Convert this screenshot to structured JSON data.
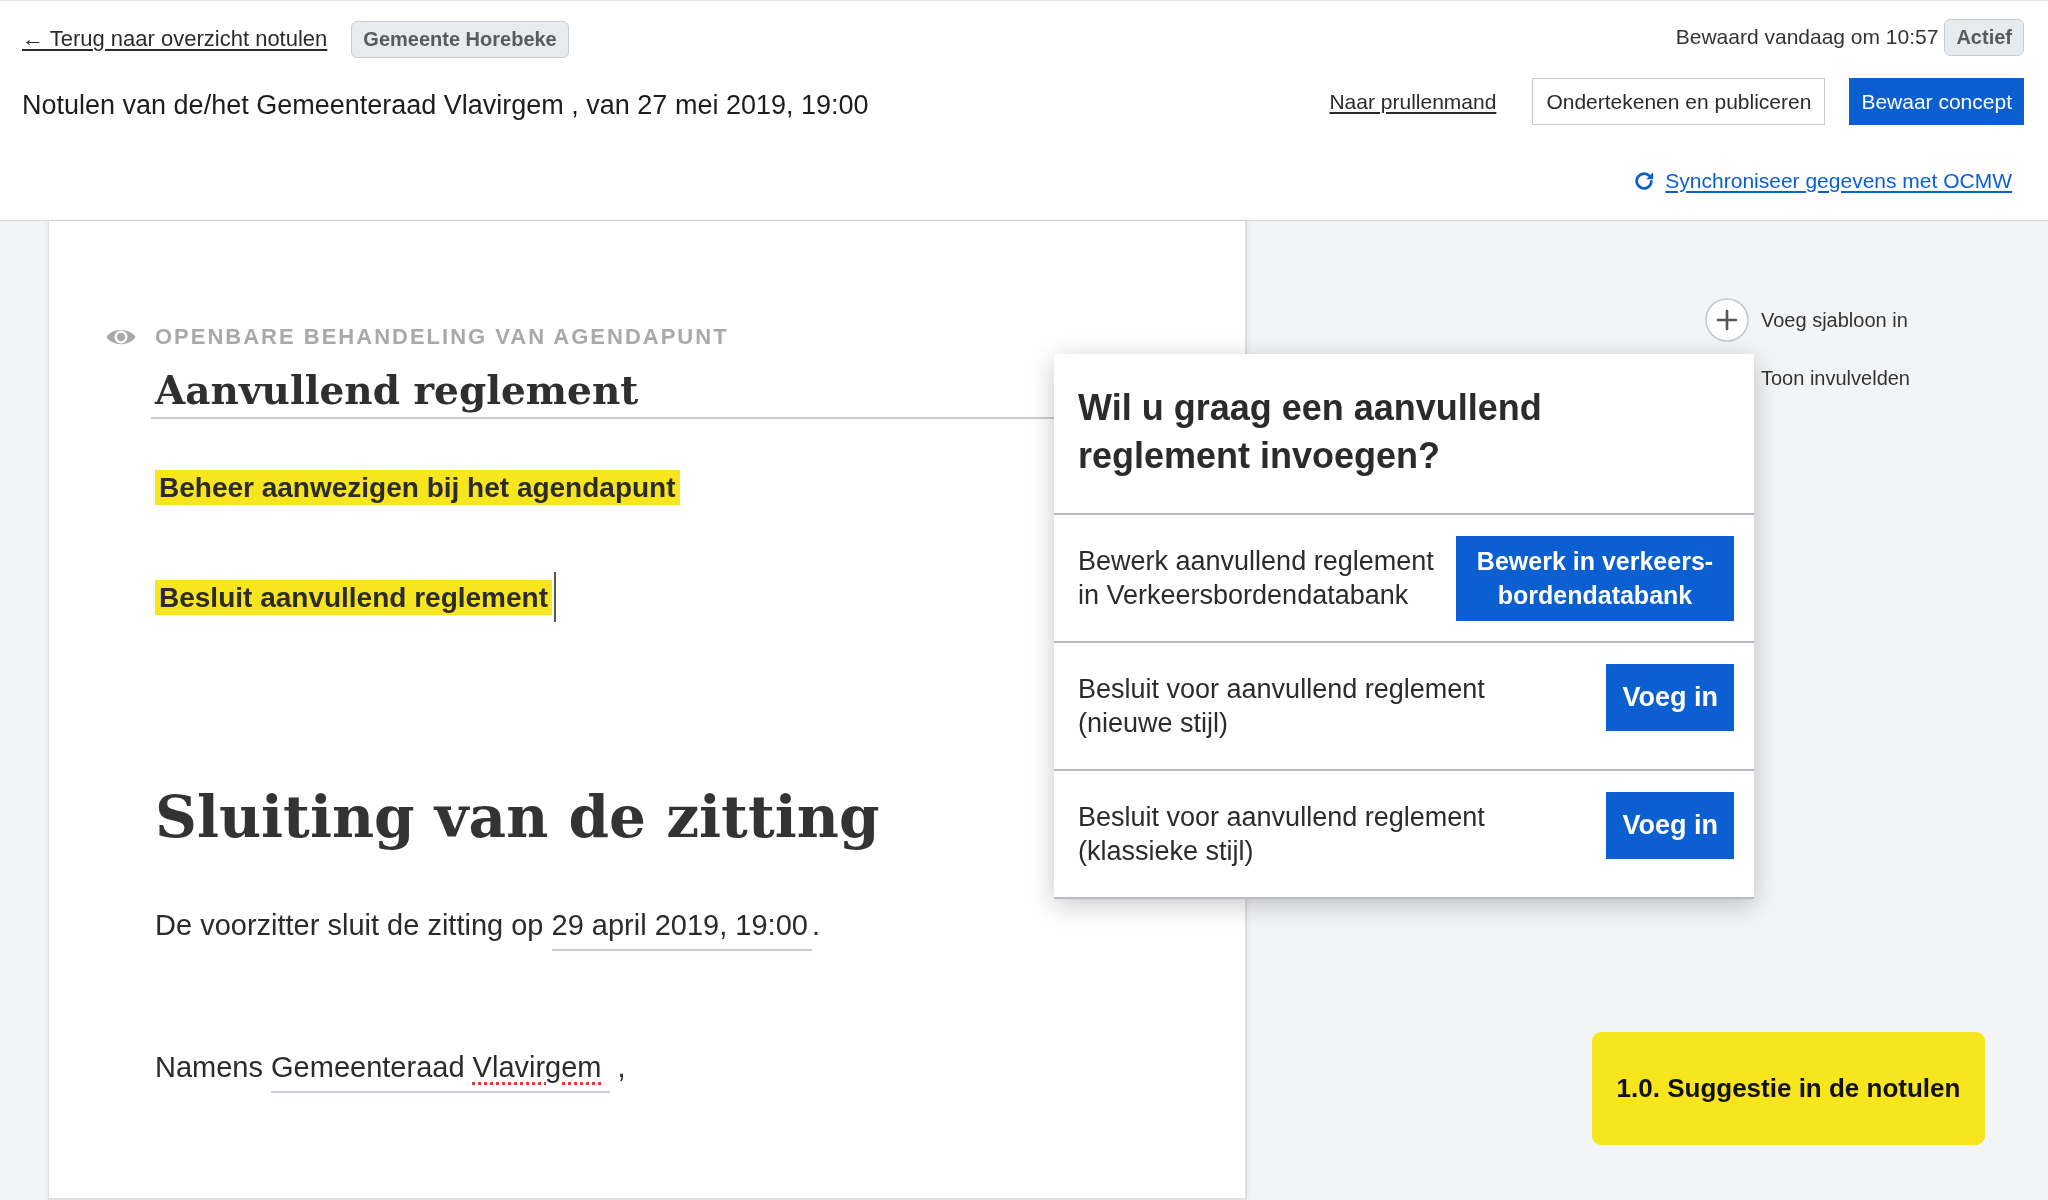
{
  "header": {
    "back_link": "← Terug naar overzicht notulen",
    "organization": "Gemeente Horebeke",
    "save_status": "Bewaard vandaag om 10:57",
    "status_badge": "Actief",
    "title": "Notulen van de/het Gemeenteraad Vlavirgem , van 27 mei 2019, 19:00",
    "actions": [
      {
        "kind": "link",
        "label": "Naar prullenmand"
      },
      {
        "kind": "secondary",
        "label": "Ondertekenen en publiceren"
      },
      {
        "kind": "primary",
        "label": "Bewaar concept"
      }
    ],
    "sync_link": "Synchroniseer gegevens met OCMW"
  },
  "document": {
    "section_label": "OPENBARE BEHANDELING VAN AGENDAPUNT",
    "agenda_title": "Aanvullend reglement",
    "highlighted_blocks": [
      {
        "text": "Beheer aanwezigen bij het agendapunt",
        "caret": false
      },
      {
        "text": "Besluit aanvullend reglement",
        "caret": true
      }
    ],
    "closing_heading": "Sluiting van de zitting",
    "closing_paragraph": {
      "before": "De voorzitter sluit de zitting op",
      "field": "29 april 2019, 19:00",
      "after": "."
    },
    "signature_line": {
      "before": "Namens",
      "field_words": [
        {
          "text": "Gemeenteraad",
          "misspelled": false
        },
        {
          "text": "Vlavirgem",
          "misspelled": true
        }
      ],
      "after": ","
    }
  },
  "sidebar": {
    "items": [
      {
        "label": "Voeg sjabloon in",
        "has_icon": true
      },
      {
        "label": "Toon invulvelden",
        "has_icon": false
      }
    ]
  },
  "popup": {
    "title": "Wil u graag een aanvullend reglement invoegen?",
    "options": [
      {
        "description": "Bewerk aanvullend reglement in Verkeersbordendatabank",
        "button": "Bewerk in verkeers-bordendatabank"
      },
      {
        "description": "Besluit voor aanvullend reglement (nieuwe stijl)",
        "button": "Voeg in"
      },
      {
        "description": "Besluit voor aanvullend reglement (klassieke stijl)",
        "button": "Voeg in"
      }
    ]
  },
  "suggestion_label": "1.0. Suggestie in de notulen"
}
